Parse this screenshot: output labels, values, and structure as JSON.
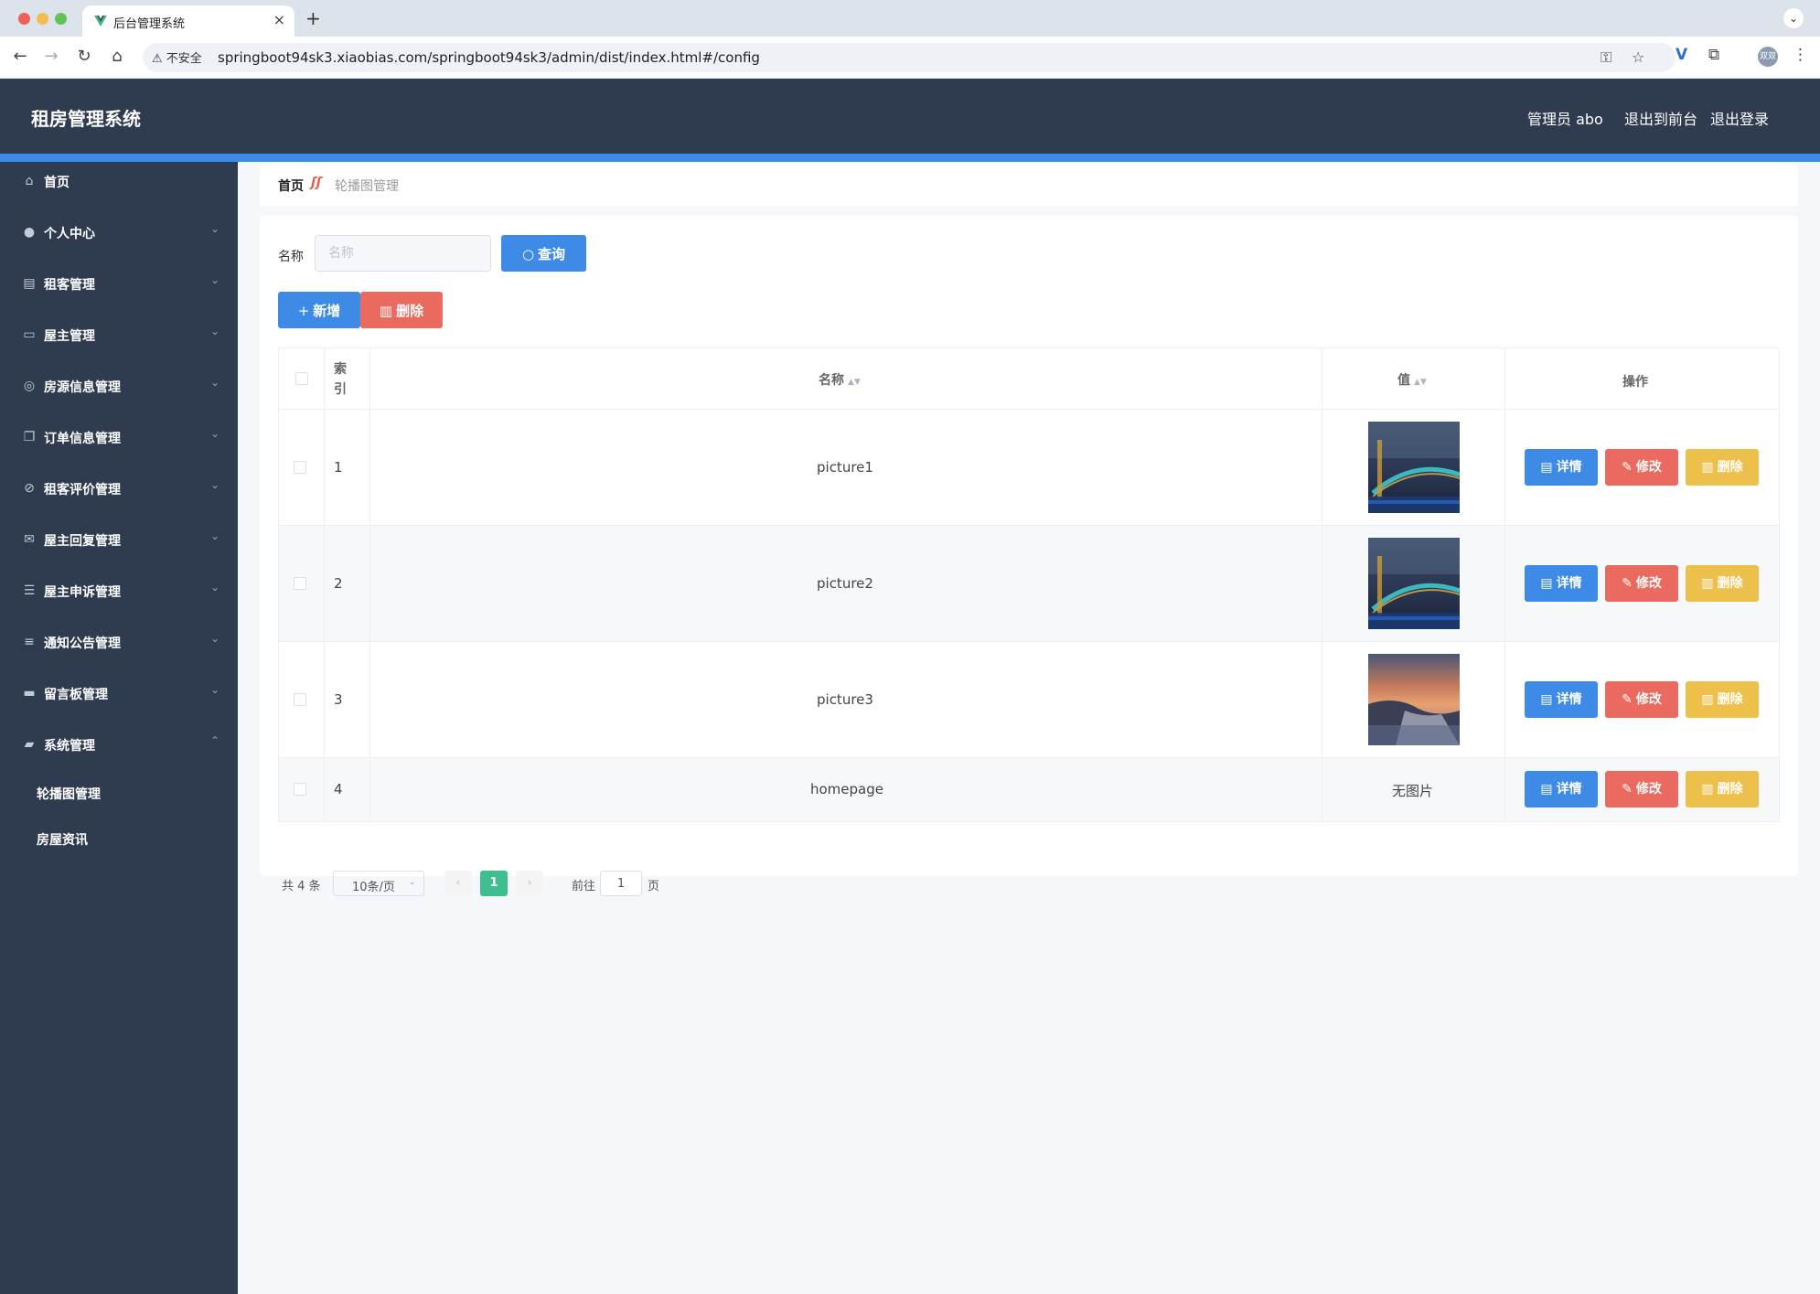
{
  "browser": {
    "tab_title": "后台管理系统",
    "security_label": "不安全",
    "url": "springboot94sk3.xiaobias.com/springboot94sk3/admin/dist/index.html#/config",
    "profile_text": "双双"
  },
  "header": {
    "title": "租房管理系统",
    "admin_label": "管理员 abo",
    "to_front_label": "退出到前台",
    "logout_label": "退出登录"
  },
  "sidebar": {
    "items": [
      {
        "label": "首页",
        "icon": "home-icon"
      },
      {
        "label": "个人中心",
        "icon": "user-icon"
      },
      {
        "label": "租客管理",
        "icon": "clipboard-icon"
      },
      {
        "label": "屋主管理",
        "icon": "id-card-icon"
      },
      {
        "label": "房源信息管理",
        "icon": "compass-icon"
      },
      {
        "label": "订单信息管理",
        "icon": "copy-icon"
      },
      {
        "label": "租客评价管理",
        "icon": "bell-off-icon"
      },
      {
        "label": "屋主回复管理",
        "icon": "message-icon"
      },
      {
        "label": "屋主申诉管理",
        "icon": "sliders-icon"
      },
      {
        "label": "通知公告管理",
        "icon": "list-icon"
      },
      {
        "label": "留言板管理",
        "icon": "printer-icon"
      },
      {
        "label": "系统管理",
        "icon": "wallet-icon"
      }
    ],
    "sub_items": [
      {
        "label": "轮播图管理"
      },
      {
        "label": "房屋资讯"
      }
    ]
  },
  "breadcrumb": {
    "home": "首页",
    "current": "轮播图管理"
  },
  "search": {
    "label": "名称",
    "placeholder": "名称",
    "button_label": "查询"
  },
  "toolbar": {
    "add_label": "新增",
    "delete_label": "删除"
  },
  "table": {
    "headers": {
      "index": "索引",
      "name": "名称",
      "value": "值",
      "ops": "操作"
    },
    "rows": [
      {
        "index": "1",
        "name": "picture1",
        "value": "",
        "image": "bridge-night"
      },
      {
        "index": "2",
        "name": "picture2",
        "value": "",
        "image": "bridge-night"
      },
      {
        "index": "3",
        "name": "picture3",
        "value": "",
        "image": "sunset-coast"
      },
      {
        "index": "4",
        "name": "homepage",
        "value": "无图片",
        "image": ""
      }
    ],
    "ops": {
      "detail": "详情",
      "edit": "修改",
      "delete": "删除"
    }
  },
  "pagination": {
    "total": "共 4 条",
    "page_size": "10条/页",
    "current_page": "1",
    "goto_label": "前往",
    "goto_value": "1",
    "page_unit": "页"
  },
  "colors": {
    "header_bg": "#2f3b4f",
    "accent": "#3d8be6",
    "danger": "#ea6a5f",
    "warning": "#ecc04a",
    "pager_active": "#3fbf8f"
  }
}
